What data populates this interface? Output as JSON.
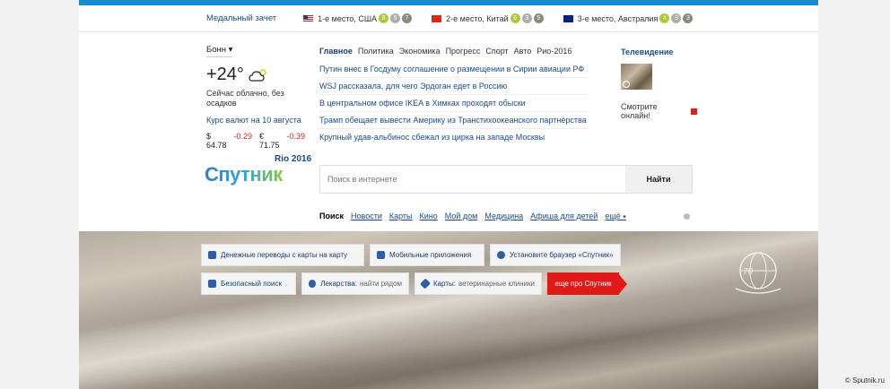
{
  "medals": {
    "title": "Медальный зачет",
    "entries": [
      {
        "place": "1-е место, США",
        "flag": "us",
        "gold": "8",
        "silver": "5",
        "bronze": "7"
      },
      {
        "place": "2-е место, Китай",
        "flag": "cn",
        "gold": "6",
        "silver": "3",
        "bronze": "5"
      },
      {
        "place": "3-е место, Австралия",
        "flag": "au",
        "gold": "4",
        "silver": "3",
        "bronze": "3"
      }
    ]
  },
  "weather": {
    "city": "Бонн",
    "city_arrow": "▾",
    "temp": "+24°",
    "desc": "Сейчас облачно, без осадков"
  },
  "rates": {
    "title": "Курс валют на 10 августа",
    "usd": "$ 64.78",
    "usd_change": "-0.29",
    "eur": "€ 71.75",
    "eur_change": "-0.39"
  },
  "news": {
    "tabs": [
      "Главное",
      "Политика",
      "Экономика",
      "Прогресс",
      "Спорт",
      "Авто",
      "Рио-2016"
    ],
    "items": [
      "Путин внес в Госдуму соглашение о размещении в Сирии авиации РФ",
      "WSJ рассказала, для чего Эрдоган едет в Россию",
      "В центральном офисе IKEA в Химках проходят обыски",
      "Трамп обещает вывести Америку из Транстихоокеанского партнёрства",
      "Крупный удав-альбинос сбежал из цирка на западе Москвы"
    ]
  },
  "tv": {
    "title": "Телевидение",
    "link": "Смотрите онлайн!"
  },
  "logo": {
    "rio": "Rio 2016",
    "brand": "Спутник"
  },
  "search": {
    "placeholder": "Поиск в интернете",
    "button": "Найти",
    "nav": [
      "Поиск",
      "Новости",
      "Карты",
      "Кино",
      "Мой дом",
      "Медицина",
      "Афиша для детей",
      "ещё"
    ],
    "more_arrow": "▾"
  },
  "tiles": {
    "row1": [
      {
        "label": "Денежные переводы с карты на карту",
        "sub": ""
      },
      {
        "label": "Мобильные приложения",
        "sub": ""
      },
      {
        "label": "Установите браузер «Спутник»",
        "sub": ""
      }
    ],
    "row2": [
      {
        "label": "Безопасный поиск",
        "sub": ""
      },
      {
        "label": "Лекарства:",
        "sub": "найти рядом"
      },
      {
        "label": "Карты:",
        "sub": "ветеринарные клиники"
      }
    ],
    "more": "еще про Спутник"
  },
  "emblem_text": "70",
  "copyright": "© Sputnik.ru"
}
